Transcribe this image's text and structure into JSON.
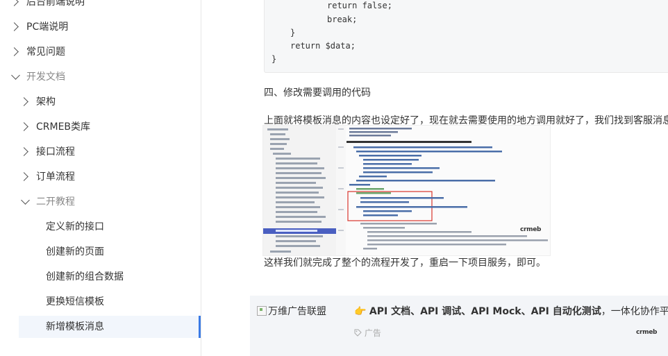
{
  "sidebar": {
    "items": [
      {
        "label": "后台前端说明",
        "state": "collapsed"
      },
      {
        "label": "PC端说明",
        "state": "collapsed"
      },
      {
        "label": "常见问题",
        "state": "collapsed"
      },
      {
        "label": "开发文档",
        "state": "expanded"
      },
      {
        "label": "架构",
        "state": "collapsed"
      },
      {
        "label": "CRMEB类库",
        "state": "collapsed"
      },
      {
        "label": "接口流程",
        "state": "collapsed"
      },
      {
        "label": "订单流程",
        "state": "collapsed"
      },
      {
        "label": "二开教程",
        "state": "expanded"
      },
      {
        "label": "定义新的接口"
      },
      {
        "label": "创建新的页面"
      },
      {
        "label": "创建新的组合数据"
      },
      {
        "label": "更换短信模板"
      },
      {
        "label": "新增模板消息",
        "active": true
      }
    ],
    "accent_color": "#3b7be5"
  },
  "code": {
    "lines": [
      "return false;",
      "break;",
      "}",
      "return $data;",
      "}"
    ]
  },
  "content": {
    "heading": "四、修改需要调用的代码",
    "para1": "上面就将模板消息的内容也设定好了，现在就去需要使用的地方调用就好了，我们找到客服消息",
    "para2": "这样我们就完成了整个的流程开发了，重启一下项目服务，即可。",
    "watermark": "crmeb"
  },
  "ad": {
    "image_alt": "万维广告联盟",
    "emoji": "👉",
    "text_bold": "API 文档、API 调试、API Mock、API 自动化测试",
    "text_rest": "，一体化协作平台",
    "tag": "广告",
    "logo": "crmeb"
  }
}
